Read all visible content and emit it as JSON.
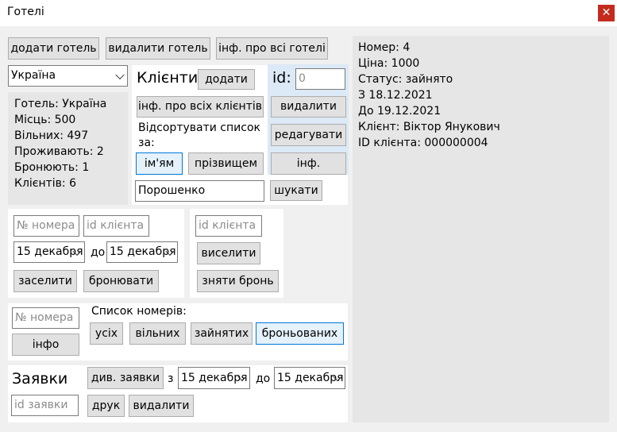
{
  "window": {
    "title": "Готелі",
    "close_glyph": "✕"
  },
  "toolbar": {
    "add_hotel": "додати готель",
    "delete_hotel": "видалити готель",
    "all_hotels_info": "інф. про всі готелі"
  },
  "hotel_select": {
    "value": "Україна"
  },
  "hotel_stats": {
    "lines": [
      "Готель: Україна",
      "Місць: 500",
      "Вільних: 497",
      "Проживають: 2",
      "Бронюють: 1",
      "Клієнтів: 6"
    ]
  },
  "clients": {
    "heading": "Клієнти",
    "add": "додати",
    "all_info": "інф. про всіх клієнтів",
    "sort_label_1": "Відсортувати список",
    "sort_label_2": "за:",
    "sort_by_name": "ім'ям",
    "sort_by_surname": "прізвищем",
    "search_value": "Порошенко",
    "search_button": "шукати",
    "id_label": "id:",
    "id_placeholder": "0",
    "delete": "видалити",
    "edit": "редагувати",
    "info": "інф."
  },
  "checkin": {
    "room_placeholder": "№ номера",
    "client_placeholder": "id клієнта",
    "date_from": "15 декабря",
    "to_label": "до",
    "date_to": "15 декабря",
    "checkin_button": "заселити",
    "book_button": "бронювати"
  },
  "checkout": {
    "client_placeholder": "id клієнта",
    "checkout_button": "виселити",
    "cancel_booking_button": "зняти бронь"
  },
  "rooms": {
    "room_placeholder": "№ номера",
    "info_button": "інфо",
    "list_label": "Список номерів:",
    "all": "усіх",
    "free": "вільних",
    "occupied": "зайнятих",
    "booked": "броньованих"
  },
  "requests": {
    "heading": "Заявки",
    "view_button": "див. заявки",
    "from_label": "з",
    "date_from": "15 декабря",
    "to_label": "до",
    "date_to": "15 декабря",
    "id_placeholder": "id заявки",
    "print_button": "друк",
    "delete_button": "видалити"
  },
  "details": {
    "lines": [
      "Номер: 4",
      "Ціна: 1000",
      "Статус: зайнято",
      "З 18.12.2021",
      "До 19.12.2021",
      "Клієнт: Віктор Янукович",
      "ID клієнта: 000000004"
    ]
  }
}
